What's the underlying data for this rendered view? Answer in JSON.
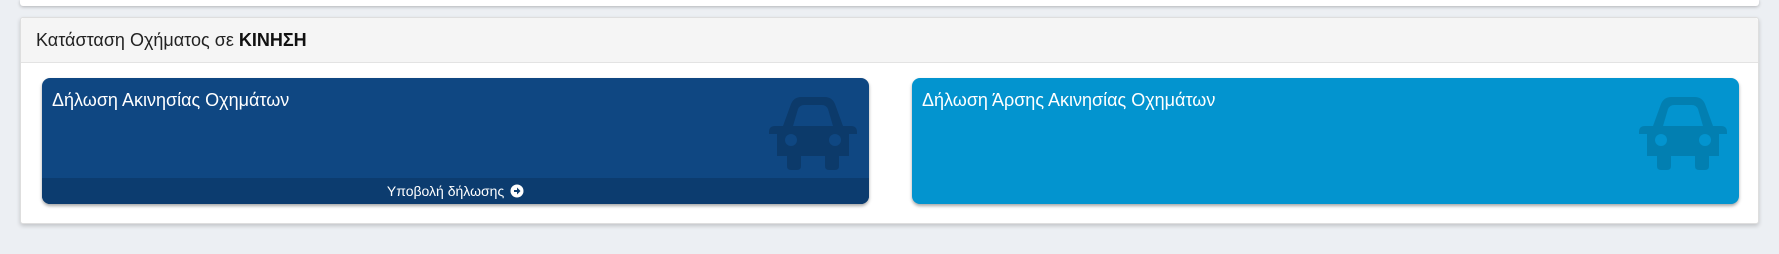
{
  "panel": {
    "title_prefix": "Κατάσταση Οχήματος σε ",
    "title_bold": "ΚΙΝΗΣΗ"
  },
  "cards": [
    {
      "title": "Δήλωση Ακινησίας Οχημάτων",
      "footer_label": "Υποβολή δήλωσης",
      "icon": "car-icon",
      "footer_icon": "arrow-circle-right-icon",
      "color": "#0f4782"
    },
    {
      "title": "Δήλωση Άρσης Ακινησίας Οχημάτων",
      "icon": "car-icon",
      "color": "#0394cf"
    }
  ]
}
